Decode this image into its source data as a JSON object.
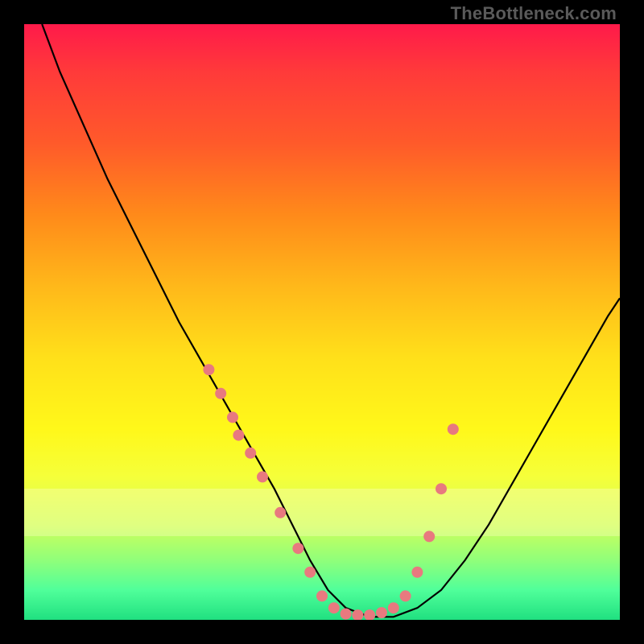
{
  "attribution": "TheBottleneck.com",
  "colors": {
    "background": "#000000",
    "curve": "#000000",
    "marker": "#e8797f",
    "gradient_top": "#ff1a4a",
    "gradient_bottom": "#20e080"
  },
  "chart_data": {
    "type": "line",
    "title": "",
    "xlabel": "",
    "ylabel": "",
    "xlim": [
      0,
      100
    ],
    "ylim": [
      0,
      100
    ],
    "grid": false,
    "legend": false,
    "highlight_bands": [
      {
        "y_from": 78,
        "y_to": 86,
        "rgba": "255,255,200,0.35"
      }
    ],
    "series": [
      {
        "name": "bottleneck-curve",
        "x": [
          3,
          6,
          10,
          14,
          18,
          22,
          26,
          30,
          34,
          38,
          42,
          45,
          48,
          51,
          54,
          58,
          62,
          66,
          70,
          74,
          78,
          82,
          86,
          90,
          94,
          98,
          100
        ],
        "y": [
          100,
          92,
          83,
          74,
          66,
          58,
          50,
          43,
          36,
          29,
          22,
          16,
          10,
          5,
          2,
          0.5,
          0.5,
          2,
          5,
          10,
          16,
          23,
          30,
          37,
          44,
          51,
          54
        ]
      }
    ],
    "markers": {
      "name": "highlight-points",
      "x": [
        31,
        33,
        35,
        36,
        38,
        40,
        43,
        46,
        48,
        50,
        52,
        54,
        56,
        58,
        60,
        62,
        64,
        66,
        68,
        70,
        72
      ],
      "y": [
        42,
        38,
        34,
        31,
        28,
        24,
        18,
        12,
        8,
        4,
        2,
        1,
        0.8,
        0.8,
        1.2,
        2,
        4,
        8,
        14,
        22,
        32
      ]
    }
  }
}
